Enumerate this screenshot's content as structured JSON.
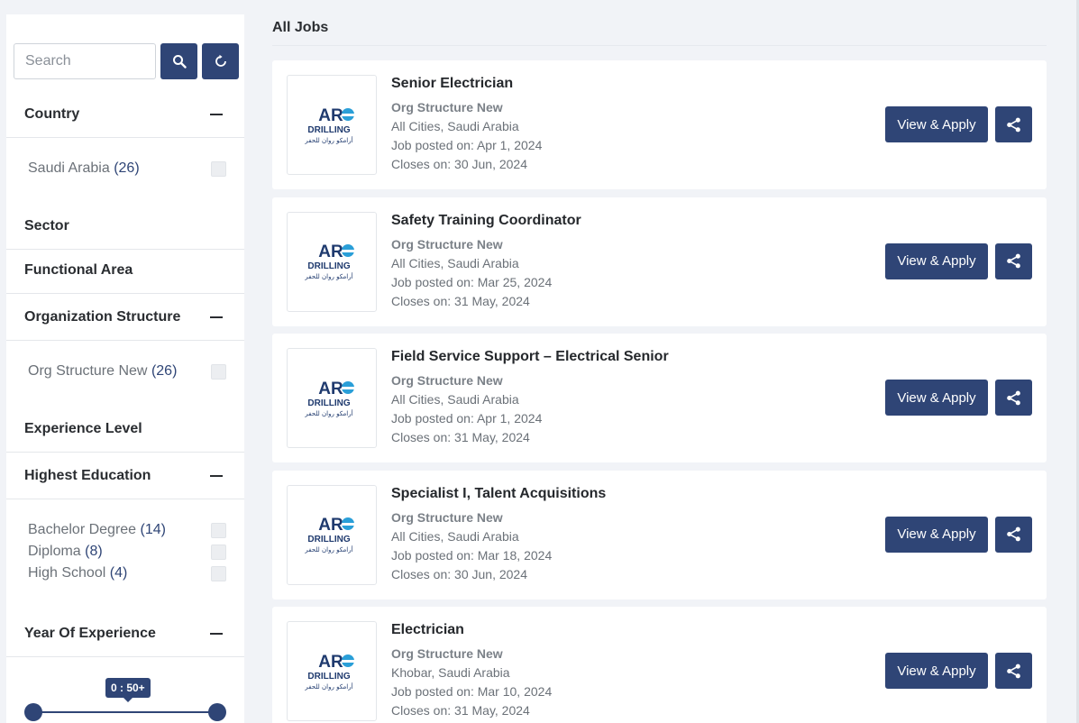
{
  "sidebar": {
    "search_placeholder": "Search",
    "filters": {
      "country": {
        "title": "Country",
        "options": [
          {
            "label": "Saudi Arabia",
            "count": "(26)"
          }
        ]
      },
      "sector": {
        "title": "Sector"
      },
      "functional_area": {
        "title": "Functional Area"
      },
      "org_structure": {
        "title": "Organization Structure",
        "options": [
          {
            "label": "Org Structure New",
            "count": "(26)"
          }
        ]
      },
      "experience_level": {
        "title": "Experience Level"
      },
      "education": {
        "title": "Highest Education",
        "options": [
          {
            "label": "Bachelor Degree",
            "count": "(14)"
          },
          {
            "label": "Diploma",
            "count": "(8)"
          },
          {
            "label": "High School",
            "count": "(4)"
          }
        ]
      },
      "years": {
        "title": "Year Of Experience",
        "range_label": "0 : 50+",
        "range_min_fraction": 0,
        "range_max_fraction": 1
      }
    }
  },
  "main": {
    "title": "All Jobs",
    "apply_label": "View & Apply",
    "jobs": [
      {
        "title": "Senior Electrician",
        "org": "Org Structure New",
        "location": "All Cities, Saudi Arabia",
        "posted": "Job posted on: Apr 1, 2024",
        "closes": "Closes on: 30 Jun, 2024"
      },
      {
        "title": "Safety Training Coordinator",
        "org": "Org Structure New",
        "location": "All Cities, Saudi Arabia",
        "posted": "Job posted on: Mar 25, 2024",
        "closes": "Closes on: 31 May, 2024"
      },
      {
        "title": "Field Service Support – Electrical Senior",
        "org": "Org Structure New",
        "location": "All Cities, Saudi Arabia",
        "posted": "Job posted on: Apr 1, 2024",
        "closes": "Closes on: 31 May, 2024"
      },
      {
        "title": "Specialist I, Talent Acquisitions",
        "org": "Org Structure New",
        "location": "All Cities, Saudi Arabia",
        "posted": "Job posted on: Mar 18, 2024",
        "closes": "Closes on: 30 Jun, 2024"
      },
      {
        "title": "Electrician",
        "org": "Org Structure New",
        "location": "Khobar, Saudi Arabia",
        "posted": "Job posted on: Mar 10, 2024",
        "closes": "Closes on: 31 May, 2024"
      }
    ]
  },
  "logo": {
    "line1": "ARO",
    "line2": "DRILLING",
    "line3": "أرامكو روان للحفر"
  },
  "colors": {
    "primary": "#2f4576",
    "logo_dark": "#1f3a6e",
    "logo_accent": "#2a9fd8"
  },
  "icons": {
    "search": "search-icon",
    "reset": "refresh-icon",
    "share": "share-icon",
    "collapse": "minus-icon"
  }
}
